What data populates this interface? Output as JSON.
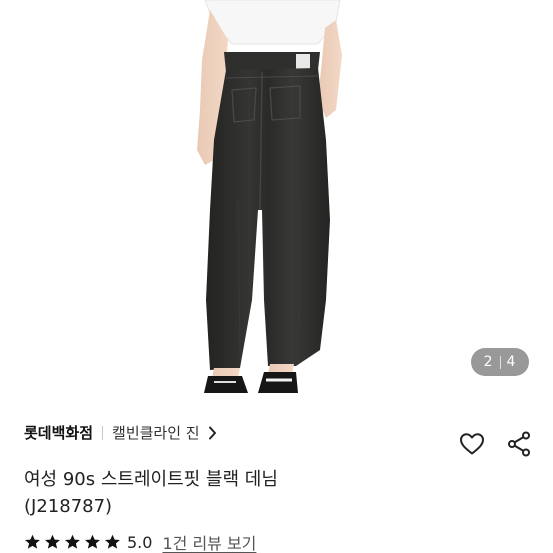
{
  "gallery": {
    "current": "2",
    "total": "4"
  },
  "product": {
    "store": "롯데백화점",
    "brand": "캘빈클라인 진",
    "title_line1": "여성 90s 스트레이트핏 블랙 데님",
    "title_line2": "(J218787)",
    "rating": "5.0",
    "stars": 5,
    "reviews_link": "1건 리뷰 보기"
  },
  "icons": {
    "brand_chevron": "chevron-right-icon",
    "wishlist": "heart-outline-icon",
    "share": "share-icon",
    "star": "star-filled-icon"
  },
  "colors": {
    "jeans": "#2b2b2a",
    "star": "#111111",
    "counter_bg": "#6e6e6e"
  }
}
